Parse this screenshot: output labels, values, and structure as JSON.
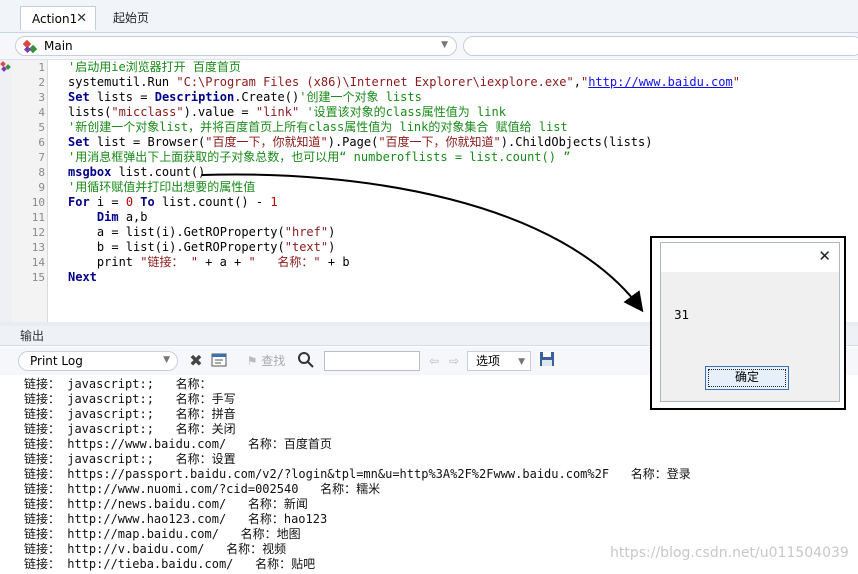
{
  "tabs": {
    "action": "Action1",
    "start": "起始页"
  },
  "editor_combo": {
    "value": "Main"
  },
  "code": {
    "line_numbers": [
      "1",
      "2",
      "3",
      "4",
      "5",
      "6",
      "7",
      "8",
      "9",
      "10",
      "11",
      "12",
      "13",
      "14",
      "15"
    ],
    "lines": [
      [
        {
          "t": "cm",
          "v": "'启动用ie浏览器打开 百度首页"
        }
      ],
      [
        {
          "t": "",
          "v": "systemutil.Run "
        },
        {
          "t": "st",
          "v": "\"C:\\Program Files (x86)\\Internet Explorer\\iexplore.exe\""
        },
        {
          "t": "",
          "v": ","
        },
        {
          "t": "st",
          "v": "\""
        },
        {
          "t": "lk",
          "v": "http://www.baidu.com"
        },
        {
          "t": "st",
          "v": "\""
        }
      ],
      [
        {
          "t": "kw",
          "v": "Set"
        },
        {
          "t": "",
          "v": " lists = "
        },
        {
          "t": "kw",
          "v": "Description"
        },
        {
          "t": "",
          "v": ".Create()"
        },
        {
          "t": "cm",
          "v": "'创建一个对象 lists"
        }
      ],
      [
        {
          "t": "",
          "v": "lists("
        },
        {
          "t": "st",
          "v": "\"micclass\""
        },
        {
          "t": "",
          "v": ").value = "
        },
        {
          "t": "st",
          "v": "\"link\""
        },
        {
          "t": "cm",
          "v": " '设置该对象的class属性值为 link"
        }
      ],
      [
        {
          "t": "cm",
          "v": "'新创建一个对象list，并将百度首页上所有class属性值为 link的对象集合 赋值给 list"
        }
      ],
      [
        {
          "t": "kw",
          "v": "Set"
        },
        {
          "t": "",
          "v": " list = Browser("
        },
        {
          "t": "st",
          "v": "\"百度一下，你就知道\""
        },
        {
          "t": "",
          "v": ").Page("
        },
        {
          "t": "st",
          "v": "\"百度一下，你就知道\""
        },
        {
          "t": "",
          "v": ").ChildObjects(lists)"
        }
      ],
      [
        {
          "t": "cm",
          "v": "'用消息框弹出下上面获取的子对象总数，也可以用“ numberoflists = list.count() ”"
        }
      ],
      [
        {
          "t": "kw",
          "v": "msgbox"
        },
        {
          "t": "",
          "v": " list.count()"
        }
      ],
      [
        {
          "t": "cm",
          "v": "'用循环赋值并打印出想要的属性值"
        }
      ],
      [
        {
          "t": "kw",
          "v": "For"
        },
        {
          "t": "",
          "v": " i = "
        },
        {
          "t": "num",
          "v": "0"
        },
        {
          "t": "",
          "v": " "
        },
        {
          "t": "kw",
          "v": "To"
        },
        {
          "t": "",
          "v": " list.count() - "
        },
        {
          "t": "num",
          "v": "1"
        }
      ],
      [
        {
          "t": "",
          "v": "    "
        },
        {
          "t": "kw",
          "v": "Dim"
        },
        {
          "t": "",
          "v": " a,b"
        }
      ],
      [
        {
          "t": "",
          "v": "    a = list(i).GetROProperty("
        },
        {
          "t": "st",
          "v": "\"href\""
        },
        {
          "t": "",
          "v": ")"
        }
      ],
      [
        {
          "t": "",
          "v": "    b = list(i).GetROProperty("
        },
        {
          "t": "st",
          "v": "\"text\""
        },
        {
          "t": "",
          "v": ")"
        }
      ],
      [
        {
          "t": "",
          "v": "    print "
        },
        {
          "t": "st",
          "v": "\"链接： \""
        },
        {
          "t": "",
          "v": " + a + "
        },
        {
          "t": "st",
          "v": "\"   名称：\""
        },
        {
          "t": "",
          "v": " + b"
        }
      ],
      [
        {
          "t": "kw",
          "v": "Next"
        }
      ]
    ]
  },
  "output": {
    "title": "输出",
    "filter_value": "Print Log",
    "find_label": "查找",
    "options_label": "选项",
    "search_value": "",
    "log_lines": [
      "链接： javascript:;   名称：",
      "链接： javascript:;   名称：手写",
      "链接： javascript:;   名称：拼音",
      "链接： javascript:;   名称：关闭",
      "链接： https://www.baidu.com/   名称：百度首页",
      "链接： javascript:;   名称：设置",
      "链接： https://passport.baidu.com/v2/?login&tpl=mn&u=http%3A%2F%2Fwww.baidu.com%2F   名称：登录",
      "链接： http://www.nuomi.com/?cid=002540   名称：糯米",
      "链接： http://news.baidu.com/   名称：新闻",
      "链接： http://www.hao123.com/   名称：hao123",
      "链接： http://map.baidu.com/   名称：地图",
      "链接： http://v.baidu.com/   名称：视频",
      "链接： http://tieba.baidu.com/   名称：贴吧"
    ]
  },
  "dialog": {
    "message": "31",
    "ok_label": "确定",
    "close_glyph": "✕"
  },
  "watermark": "https://blog.csdn.net/u011504039",
  "colors": {
    "comment": "#1a8a1a",
    "keyword": "#00008b",
    "string": "#8b1a1a",
    "link": "#1010ee",
    "number": "#c00000"
  },
  "icons": [
    "vb-action-icon",
    "close-icon",
    "delete-icon",
    "clear-icon",
    "find-icon",
    "search-icon",
    "prev-icon",
    "next-icon",
    "save-icon",
    "chevron-down-icon"
  ]
}
